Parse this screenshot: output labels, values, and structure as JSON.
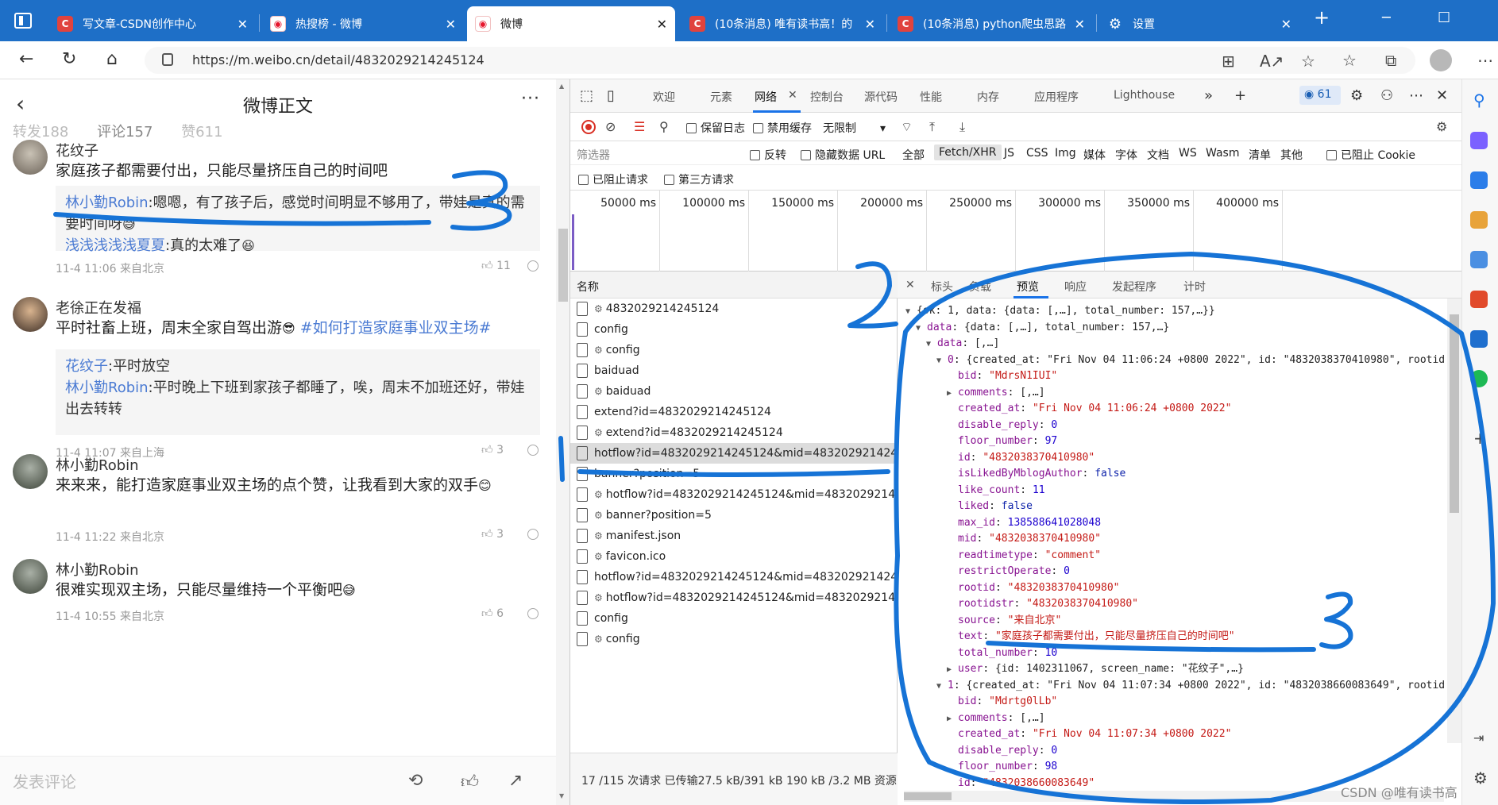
{
  "browser": {
    "tabs": [
      {
        "title": "写文章-CSDN创作中心",
        "icon": "csdn"
      },
      {
        "title": "热搜榜 - 微博",
        "icon": "weibo"
      },
      {
        "title": "微博",
        "icon": "weibo",
        "active": true
      },
      {
        "title": "(10条消息) 唯有读书高！的",
        "icon": "csdn"
      },
      {
        "title": "(10条消息) python爬虫思路",
        "icon": "csdn"
      },
      {
        "title": "设置",
        "icon": "gear"
      }
    ],
    "url": "https://m.weibo.cn/detail/4832029214245124"
  },
  "weibo": {
    "title": "微博正文",
    "tabs": {
      "reposts": "转发188",
      "comments": "评论157",
      "likes": "赞611"
    },
    "comments": [
      {
        "name": "花纹子",
        "text": "家庭孩子都需要付出，只能尽量挤压自己的时间吧",
        "replies": [
          {
            "name": "林小勤Robin",
            "text": ":嗯嗯，有了孩子后，感觉时间明显不够用了，带娃是真的需要时间呀"
          },
          {
            "name": "浅浅浅浅浅夏夏",
            "text": ":真的太难了"
          }
        ],
        "meta": "11-4 11:06 来自北京",
        "likes": "11"
      },
      {
        "name": "老徐正在发福",
        "text": "平时社畜上班，周末全家自驾出游",
        "topic": "#如何打造家庭事业双主场#",
        "replies": [
          {
            "name": "花纹子",
            "text": ":平时放空"
          },
          {
            "name": "林小勤Robin",
            "text": ":平时晚上下班到家孩子都睡了，唉，周末不加班还好，带娃出去转转"
          }
        ],
        "meta": "11-4 11:07 来自上海",
        "likes": "3"
      },
      {
        "name": "林小勤Robin",
        "text": "来来来，能打造家庭事业双主场的点个赞，让我看到大家的双手",
        "meta": "11-4 11:22 来自北京",
        "likes": "3"
      },
      {
        "name": "林小勤Robin",
        "text": "很难实现双主场，只能尽量维持一个平衡吧",
        "meta": "11-4 10:55 来自北京",
        "likes": "6"
      }
    ],
    "input_placeholder": "发表评论"
  },
  "devtools": {
    "tabs": [
      "欢迎",
      "元素",
      "网络",
      "控制台",
      "源代码",
      "性能",
      "内存",
      "应用程序",
      "Lighthouse"
    ],
    "message_count": "61",
    "toolbar": {
      "preserve_log": "保留日志",
      "disable_cache": "禁用缓存",
      "throttle": "无限制"
    },
    "filter": {
      "placeholder": "筛选器",
      "invert": "反转",
      "hide_data_url": "隐藏数据 URL",
      "types": [
        "全部",
        "Fetch/XHR",
        "JS",
        "CSS",
        "Img",
        "媒体",
        "字体",
        "文档",
        "WS",
        "Wasm",
        "清单",
        "其他"
      ],
      "selected_type": "Fetch/XHR",
      "blocked_cookie": "已阻止 Cookie",
      "blocked_req": "已阻止请求",
      "third_party": "第三方请求"
    },
    "timeline": [
      "50000 ms",
      "100000 ms",
      "150000 ms",
      "200000 ms",
      "250000 ms",
      "300000 ms",
      "350000 ms",
      "400000 ms"
    ],
    "requests_header": "名称",
    "requests": [
      {
        "name": "4832029214245124",
        "gear": true
      },
      {
        "name": "config",
        "gear": false
      },
      {
        "name": "config",
        "gear": true
      },
      {
        "name": "baiduad",
        "gear": false
      },
      {
        "name": "baiduad",
        "gear": true
      },
      {
        "name": "extend?id=4832029214245124",
        "gear": false
      },
      {
        "name": "extend?id=4832029214245124",
        "gear": true
      },
      {
        "name": "hotflow?id=4832029214245124&mid=4832029214245124&max_id_type=0",
        "gear": false,
        "selected": true
      },
      {
        "name": "banner?position=5",
        "gear": false
      },
      {
        "name": "hotflow?id=4832029214245124&mid=4832029214245124",
        "gear": true
      },
      {
        "name": "banner?position=5",
        "gear": true
      },
      {
        "name": "manifest.json",
        "gear": true
      },
      {
        "name": "favicon.ico",
        "gear": true
      },
      {
        "name": "hotflow?id=4832029214245124&mid=4832029214245124",
        "gear": false
      },
      {
        "name": "hotflow?id=4832029214245124&mid=4832029214245124",
        "gear": true
      },
      {
        "name": "config",
        "gear": false
      },
      {
        "name": "config",
        "gear": true
      }
    ],
    "status_bar": "17 /115 次请求  已传输27.5 kB/391 kB  190 kB /3.2 MB 资源",
    "detail_tabs": [
      "标头",
      "负载",
      "预览",
      "响应",
      "发起程序",
      "计时"
    ],
    "json_lines": [
      {
        "indent": 0,
        "arrow": "down",
        "parts": [
          [
            "p",
            "{ok: 1, data: {data: [,…], total_number: 157,…}}"
          ]
        ]
      },
      {
        "indent": 1,
        "arrow": "down",
        "parts": [
          [
            "k",
            "data"
          ],
          [
            "p",
            ": {data: [,…], total_number: 157,…}"
          ]
        ]
      },
      {
        "indent": 2,
        "arrow": "down",
        "parts": [
          [
            "k",
            "data"
          ],
          [
            "p",
            ": [,…]"
          ]
        ]
      },
      {
        "indent": 3,
        "arrow": "down",
        "parts": [
          [
            "k",
            "0"
          ],
          [
            "p",
            ": {created_at: \"Fri Nov 04 11:06:24 +0800 2022\", id: \"4832038370410980\", rootid"
          ]
        ]
      },
      {
        "indent": 4,
        "arrow": "",
        "parts": [
          [
            "k",
            "bid"
          ],
          [
            "p",
            ": "
          ],
          [
            "s",
            "\"MdrsN1IUI\""
          ]
        ]
      },
      {
        "indent": 4,
        "arrow": "right",
        "parts": [
          [
            "k",
            "comments"
          ],
          [
            "p",
            ": [,…]"
          ]
        ]
      },
      {
        "indent": 4,
        "arrow": "",
        "parts": [
          [
            "k",
            "created_at"
          ],
          [
            "p",
            ": "
          ],
          [
            "s",
            "\"Fri Nov 04 11:06:24 +0800 2022\""
          ]
        ]
      },
      {
        "indent": 4,
        "arrow": "",
        "parts": [
          [
            "k",
            "disable_reply"
          ],
          [
            "p",
            ": "
          ],
          [
            "n",
            "0"
          ]
        ]
      },
      {
        "indent": 4,
        "arrow": "",
        "parts": [
          [
            "k",
            "floor_number"
          ],
          [
            "p",
            ": "
          ],
          [
            "n",
            "97"
          ]
        ]
      },
      {
        "indent": 4,
        "arrow": "",
        "parts": [
          [
            "k",
            "id"
          ],
          [
            "p",
            ": "
          ],
          [
            "s",
            "\"4832038370410980\""
          ]
        ]
      },
      {
        "indent": 4,
        "arrow": "",
        "parts": [
          [
            "k",
            "isLikedByMblogAuthor"
          ],
          [
            "p",
            ": "
          ],
          [
            "b",
            "false"
          ]
        ]
      },
      {
        "indent": 4,
        "arrow": "",
        "parts": [
          [
            "k",
            "like_count"
          ],
          [
            "p",
            ": "
          ],
          [
            "n",
            "11"
          ]
        ]
      },
      {
        "indent": 4,
        "arrow": "",
        "parts": [
          [
            "k",
            "liked"
          ],
          [
            "p",
            ": "
          ],
          [
            "b",
            "false"
          ]
        ]
      },
      {
        "indent": 4,
        "arrow": "",
        "parts": [
          [
            "k",
            "max_id"
          ],
          [
            "p",
            ": "
          ],
          [
            "n",
            "138588641028048"
          ]
        ]
      },
      {
        "indent": 4,
        "arrow": "",
        "parts": [
          [
            "k",
            "mid"
          ],
          [
            "p",
            ": "
          ],
          [
            "s",
            "\"4832038370410980\""
          ]
        ]
      },
      {
        "indent": 4,
        "arrow": "",
        "parts": [
          [
            "k",
            "readtimetype"
          ],
          [
            "p",
            ": "
          ],
          [
            "s",
            "\"comment\""
          ]
        ]
      },
      {
        "indent": 4,
        "arrow": "",
        "parts": [
          [
            "k",
            "restrictOperate"
          ],
          [
            "p",
            ": "
          ],
          [
            "n",
            "0"
          ]
        ]
      },
      {
        "indent": 4,
        "arrow": "",
        "parts": [
          [
            "k",
            "rootid"
          ],
          [
            "p",
            ": "
          ],
          [
            "s",
            "\"4832038370410980\""
          ]
        ]
      },
      {
        "indent": 4,
        "arrow": "",
        "parts": [
          [
            "k",
            "rootidstr"
          ],
          [
            "p",
            ": "
          ],
          [
            "s",
            "\"4832038370410980\""
          ]
        ]
      },
      {
        "indent": 4,
        "arrow": "",
        "parts": [
          [
            "k",
            "source"
          ],
          [
            "p",
            ": "
          ],
          [
            "s",
            "\"来自北京\""
          ]
        ]
      },
      {
        "indent": 4,
        "arrow": "",
        "parts": [
          [
            "k",
            "text"
          ],
          [
            "p",
            ": "
          ],
          [
            "s",
            "\"家庭孩子都需要付出，只能尽量挤压自己的时间吧\""
          ]
        ]
      },
      {
        "indent": 4,
        "arrow": "",
        "parts": [
          [
            "k",
            "total_number"
          ],
          [
            "p",
            ": "
          ],
          [
            "n",
            "10"
          ]
        ]
      },
      {
        "indent": 4,
        "arrow": "right",
        "parts": [
          [
            "k",
            "user"
          ],
          [
            "p",
            ": {id: 1402311067, screen_name: \"花纹子\",…}"
          ]
        ]
      },
      {
        "indent": 3,
        "arrow": "down",
        "parts": [
          [
            "k",
            "1"
          ],
          [
            "p",
            ": {created_at: \"Fri Nov 04 11:07:34 +0800 2022\", id: \"4832038660083649\", rootid"
          ]
        ]
      },
      {
        "indent": 4,
        "arrow": "",
        "parts": [
          [
            "k",
            "bid"
          ],
          [
            "p",
            ": "
          ],
          [
            "s",
            "\"Mdrtg0lLb\""
          ]
        ]
      },
      {
        "indent": 4,
        "arrow": "right",
        "parts": [
          [
            "k",
            "comments"
          ],
          [
            "p",
            ": [,…]"
          ]
        ]
      },
      {
        "indent": 4,
        "arrow": "",
        "parts": [
          [
            "k",
            "created_at"
          ],
          [
            "p",
            ": "
          ],
          [
            "s",
            "\"Fri Nov 04 11:07:34 +0800 2022\""
          ]
        ]
      },
      {
        "indent": 4,
        "arrow": "",
        "parts": [
          [
            "k",
            "disable_reply"
          ],
          [
            "p",
            ": "
          ],
          [
            "n",
            "0"
          ]
        ]
      },
      {
        "indent": 4,
        "arrow": "",
        "parts": [
          [
            "k",
            "floor_number"
          ],
          [
            "p",
            ": "
          ],
          [
            "n",
            "98"
          ]
        ]
      },
      {
        "indent": 4,
        "arrow": "",
        "parts": [
          [
            "k",
            "id"
          ],
          [
            "p",
            ": "
          ],
          [
            "s",
            "\"4832038660083649\""
          ]
        ]
      }
    ]
  },
  "watermark": "CSDN @唯有读书高",
  "annotations": {
    "color": "#1673d6",
    "numbers": [
      "3",
      "2",
      "1",
      "3"
    ]
  }
}
